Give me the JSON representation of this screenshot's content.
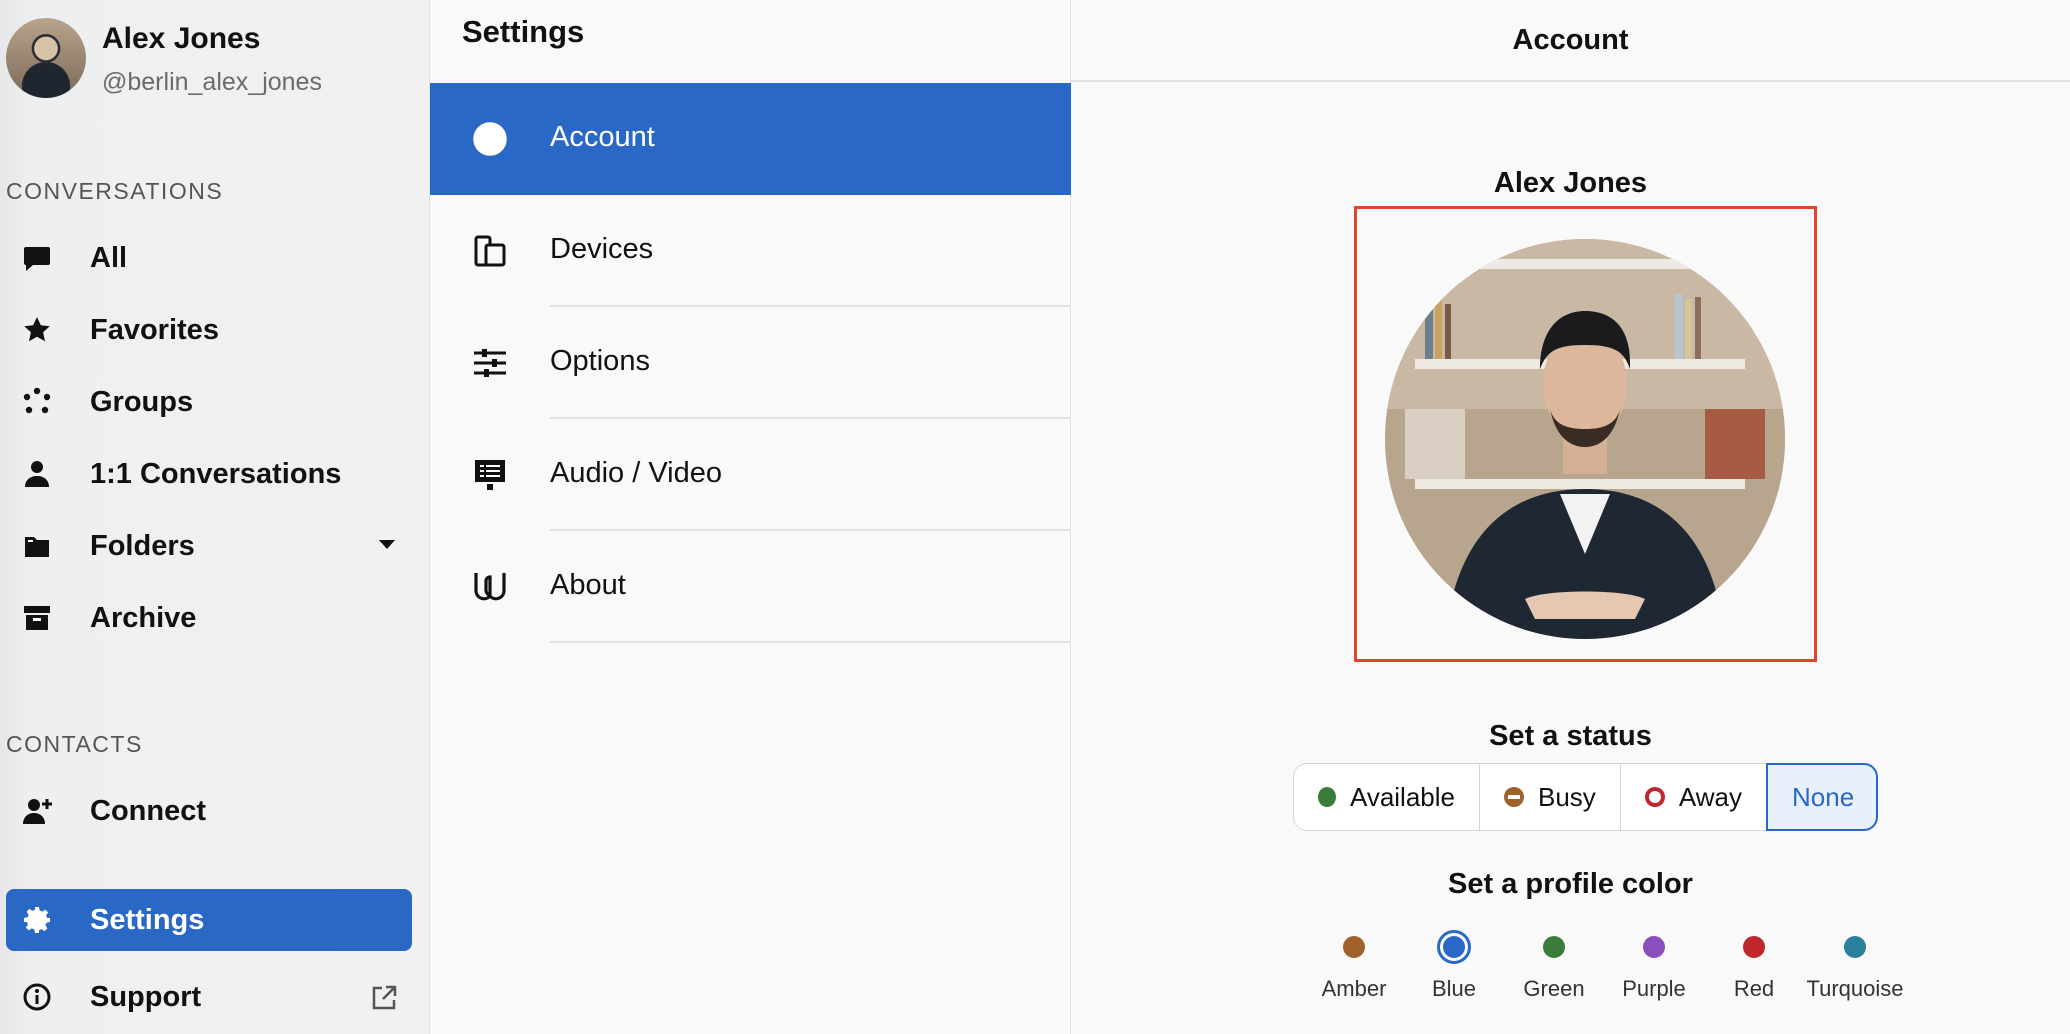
{
  "user": {
    "name": "Alex Jones",
    "handle": "@berlin_alex_jones"
  },
  "sidebar": {
    "conversations_label": "CONVERSATIONS",
    "contacts_label": "CONTACTS",
    "items": [
      {
        "label": "All",
        "icon": "chat-bubble-icon"
      },
      {
        "label": "Favorites",
        "icon": "star-icon"
      },
      {
        "label": "Groups",
        "icon": "groups-icon"
      },
      {
        "label": "1:1 Conversations",
        "icon": "person-icon"
      },
      {
        "label": "Folders",
        "icon": "folder-icon"
      },
      {
        "label": "Archive",
        "icon": "archive-icon"
      }
    ],
    "connect_label": "Connect",
    "settings_label": "Settings",
    "support_label": "Support"
  },
  "settings": {
    "title": "Settings",
    "items": [
      {
        "label": "Account",
        "icon": "account-icon",
        "active": true
      },
      {
        "label": "Devices",
        "icon": "devices-icon"
      },
      {
        "label": "Options",
        "icon": "sliders-icon"
      },
      {
        "label": "Audio / Video",
        "icon": "audio-video-icon"
      },
      {
        "label": "About",
        "icon": "wire-logo-icon"
      }
    ]
  },
  "account": {
    "header": "Account",
    "name": "Alex Jones",
    "status_label": "Set a status",
    "statuses": [
      {
        "label": "Available",
        "color": "#3a7d3a"
      },
      {
        "label": "Busy",
        "color": "#a0622a"
      },
      {
        "label": "Away",
        "color": "#c0262b"
      },
      {
        "label": "None",
        "selected": true
      }
    ],
    "color_label": "Set a profile color",
    "colors": [
      {
        "name": "Amber",
        "hex": "#a0622a"
      },
      {
        "name": "Blue",
        "hex": "#2a68c6",
        "selected": true
      },
      {
        "name": "Green",
        "hex": "#3a7d3a"
      },
      {
        "name": "Purple",
        "hex": "#8a4fbd"
      },
      {
        "name": "Red",
        "hex": "#c0262b"
      },
      {
        "name": "Turquoise",
        "hex": "#2a7f9c"
      }
    ]
  }
}
